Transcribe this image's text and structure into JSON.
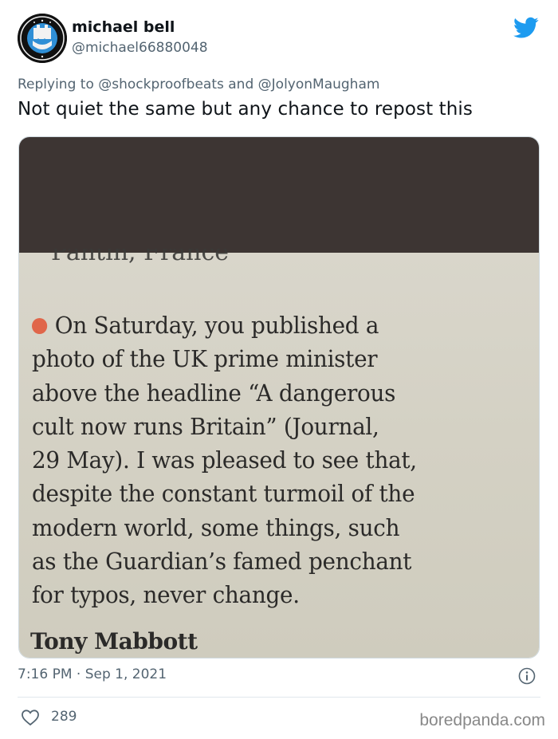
{
  "user": {
    "display_name": "michael bell",
    "handle": "@michael66880048",
    "avatar_icon": "newcastle-united-crest"
  },
  "reply": {
    "prefix": "Replying to",
    "mention_1": "@shockproofbeats",
    "conjunction": "and",
    "mention_2": "@JolyonMaugham"
  },
  "tweet": {
    "text": "Not quiet the same but any chance to repost this"
  },
  "photo": {
    "letter_lines": [
      "On Saturday, you published a",
      "photo of the UK prime minister",
      "above the headline “A dangerous",
      "cult now runs Britain” (Journal,",
      "29 May). I was pleased to see that,",
      "despite the constant turmoil of the",
      "modern world, some things, such",
      "as the Guardian’s famed penchant",
      "for typos, never change."
    ],
    "signature": "Tony Mabbott",
    "bullet_color": "#e0664a"
  },
  "meta": {
    "time": "7:16 PM",
    "separator": "·",
    "date": "Sep 1, 2021"
  },
  "actions": {
    "like_count": "289"
  },
  "watermark": "boredpanda.com",
  "colors": {
    "twitter_blue": "#1d9bf0",
    "muted_text": "#536471"
  }
}
